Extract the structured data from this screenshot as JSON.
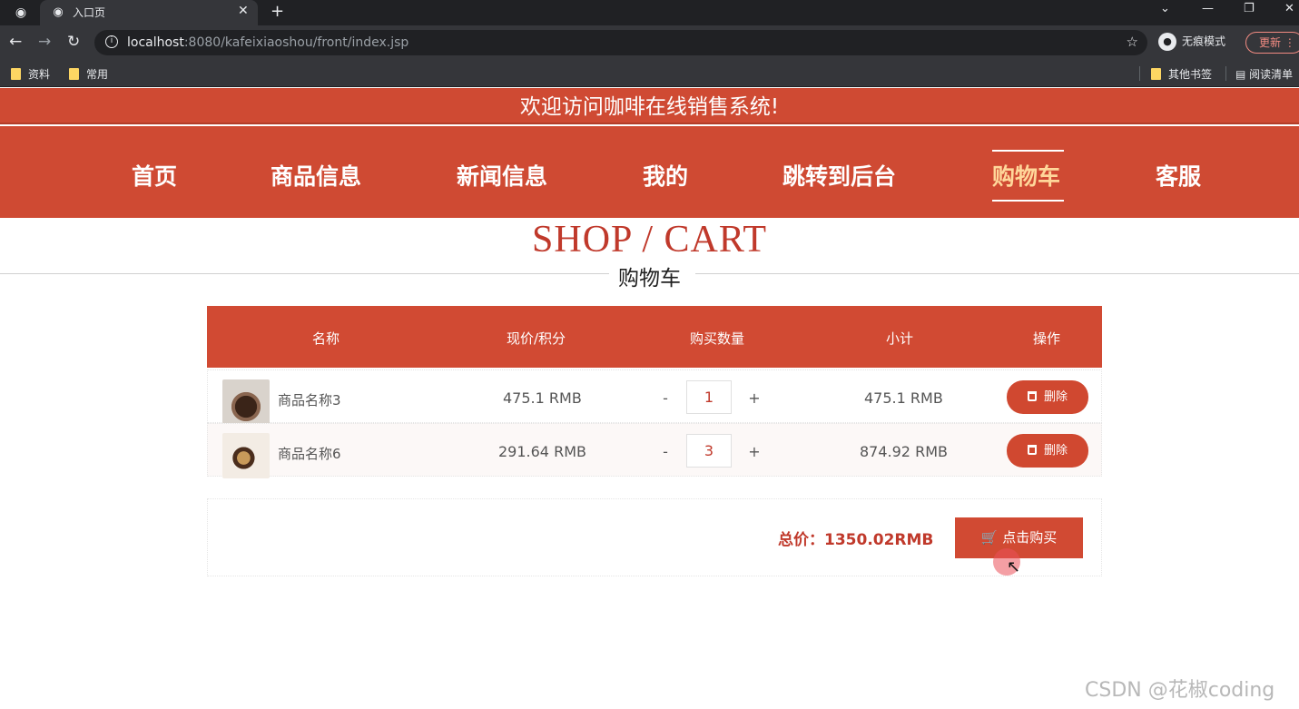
{
  "browser": {
    "tab_title": "入口页",
    "url_host": "localhost",
    "url_path": ":8080/kafeixiaoshou/front/index.jsp",
    "incognito_label": "无痕模式",
    "update_label": "更新",
    "bookmarks": [
      "资料",
      "常用"
    ],
    "bookmarks_right": [
      "其他书签",
      "阅读清单"
    ]
  },
  "site": {
    "welcome": "欢迎访问咖啡在线销售系统!",
    "nav": [
      "首页",
      "商品信息",
      "新闻信息",
      "我的",
      "跳转到后台",
      "购物车",
      "客服"
    ],
    "active_nav": "购物车",
    "page_title": "SHOP / CART",
    "page_subtitle": "购物车"
  },
  "cart": {
    "headers": [
      "名称",
      "现价/积分",
      "购买数量",
      "小计",
      "操作"
    ],
    "items": [
      {
        "name": "商品名称3",
        "price": "475.1 RMB",
        "qty": "1",
        "subtotal": "475.1 RMB",
        "action": "删除"
      },
      {
        "name": "商品名称6",
        "price": "291.64 RMB",
        "qty": "3",
        "subtotal": "874.92 RMB",
        "action": "删除"
      }
    ],
    "qty_minus": "-",
    "qty_plus": "+",
    "total": "总价：1350.02RMB",
    "buy_label": "点击购买"
  },
  "watermark": "CSDN @花椒coding",
  "colors": {
    "accent": "#cf4a33",
    "active_nav": "#ffd79a",
    "price_red": "#c0392b"
  }
}
